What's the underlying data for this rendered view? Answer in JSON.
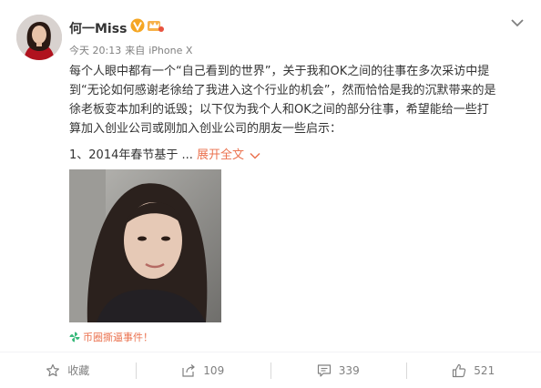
{
  "user": {
    "name": "何一Miss",
    "time": "今天 20:13",
    "source_prefix": "来自",
    "source": "iPhone X"
  },
  "post": {
    "lines": [
      "每个人眼中都有一个“自己看到的世界”，关于我和OK之间的往事在多次采访中提",
      "到“无论如何感谢老徐给了我进入这个行业的机会”，然而恰恰是我的沉默带来的是",
      "徐老板变本加利的诋毁；以下仅为我个人和OK之间的部分往事，希望能给一些打",
      "算加入创业公司或刚加入创业公司的朋友一些启示："
    ],
    "truncated_line": "1、2014年春节基于 ...",
    "expand_label": "展开全文"
  },
  "topic": {
    "label": "币圈撕逼事件！"
  },
  "actions": {
    "favorite_label": "收藏",
    "repost_count": "109",
    "comment_count": "339",
    "like_count": "521"
  },
  "colors": {
    "accent": "#eb7350",
    "verified_badge": "#f5a623",
    "text": "#333333",
    "meta": "#808080"
  },
  "icons": {
    "verified": "verified-v-icon",
    "vip": "vip-crown-icon",
    "menu": "chevron-down-icon",
    "favorite": "star-icon",
    "repost": "repost-icon",
    "comment": "comment-icon",
    "like": "thumbs-up-icon",
    "topic": "topic-pinwheel-icon"
  }
}
